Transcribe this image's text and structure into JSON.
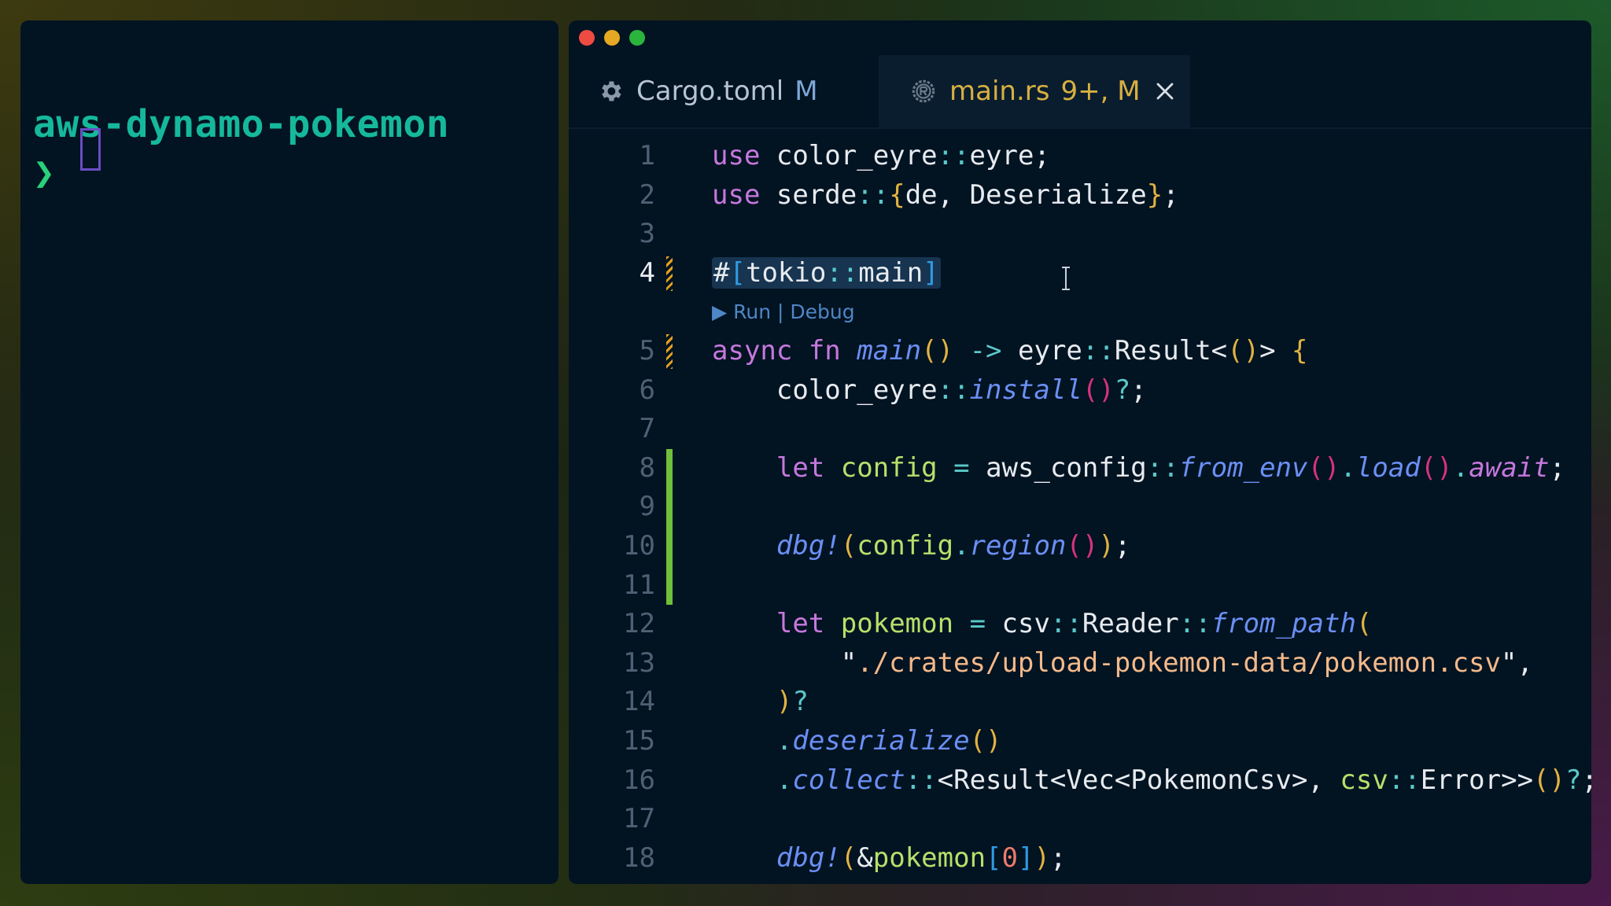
{
  "terminal": {
    "directory": "aws-dynamo-pokemon",
    "prompt_symbol": "❯"
  },
  "editor": {
    "tabs": [
      {
        "label": "Cargo.toml",
        "badge": "M",
        "icon": "gear-icon",
        "active": false
      },
      {
        "label": "main.rs",
        "badge": "9+, M",
        "icon": "rust-icon",
        "active": true,
        "close_icon": "close-icon"
      }
    ],
    "codelens": "▶ Run | Debug",
    "line_numbers": [
      "1",
      "2",
      "3",
      "4",
      "5",
      "6",
      "7",
      "8",
      "9",
      "10",
      "11",
      "12",
      "13",
      "14",
      "15",
      "16",
      "17",
      "18"
    ],
    "lines": [
      "use color_eyre::eyre;",
      "use serde::{de, Deserialize};",
      "",
      "#[tokio::main]",
      "async fn main() -> eyre::Result<()> {",
      "    color_eyre::install()?;",
      "",
      "    let config = aws_config::from_env().load().await;",
      "",
      "    dbg!(config.region());",
      "",
      "    let pokemon = csv::Reader::from_path(",
      "        \"./crates/upload-pokemon-data/pokemon.csv\",",
      "    )?",
      "    .deserialize()",
      "    .collect::<Result<Vec<PokemonCsv>, csv::Error>>()?;",
      "",
      "    dbg!(&pokemon[0]);"
    ],
    "active_line": "4",
    "modified_lines": [
      "4",
      "5"
    ],
    "added_lines": [
      "8",
      "9",
      "10",
      "11"
    ]
  },
  "colors": {
    "terminal_bg": "#021322",
    "directory_color": "#16b89c",
    "prompt_color": "#29d17a",
    "keyword": "#c678dd",
    "function": "#6b8ff3",
    "string": "#f3b98a",
    "variable": "#b6e06a",
    "active_tab_text": "#d8b040"
  }
}
